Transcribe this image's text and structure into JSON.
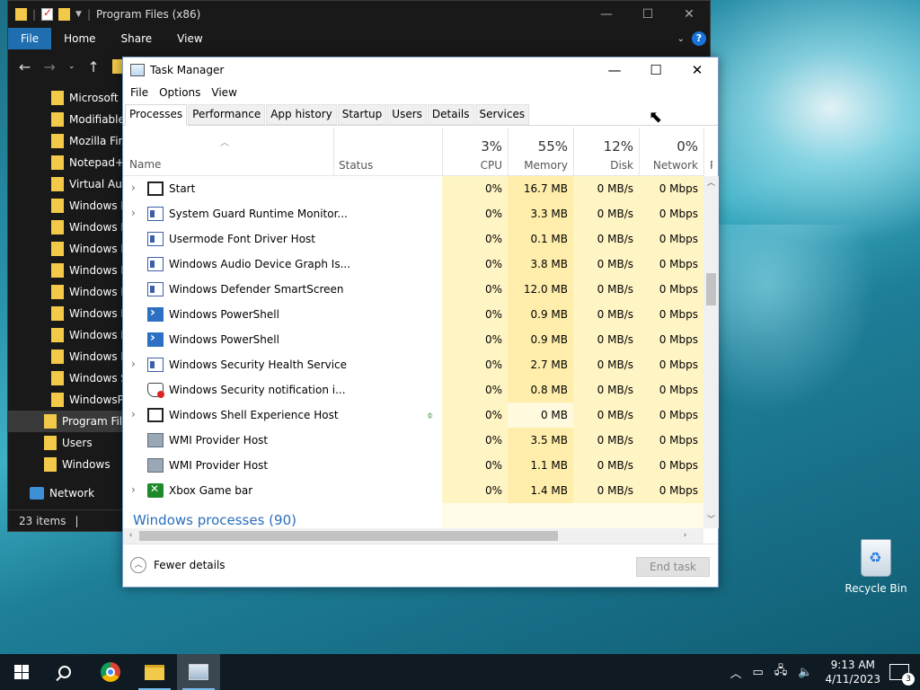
{
  "explorer": {
    "title": "Program Files (x86)",
    "ribbon_tabs": [
      "File",
      "Home",
      "Share",
      "View"
    ],
    "sidebar": [
      {
        "label": "Microsoft S",
        "type": "folder",
        "selected": false
      },
      {
        "label": "Modifiable",
        "type": "folder",
        "selected": false
      },
      {
        "label": "Mozilla Fire",
        "type": "folder",
        "selected": false
      },
      {
        "label": "Notepad++",
        "type": "folder",
        "selected": false
      },
      {
        "label": "Virtual Aud",
        "type": "folder",
        "selected": false
      },
      {
        "label": "Windows D",
        "type": "folder",
        "selected": false
      },
      {
        "label": "Windows D",
        "type": "folder",
        "selected": false
      },
      {
        "label": "Windows M",
        "type": "folder",
        "selected": false
      },
      {
        "label": "Windows M",
        "type": "folder",
        "selected": false
      },
      {
        "label": "Windows M",
        "type": "folder",
        "selected": false
      },
      {
        "label": "Windows N",
        "type": "folder",
        "selected": false
      },
      {
        "label": "Windows P",
        "type": "folder",
        "selected": false
      },
      {
        "label": "Windows P",
        "type": "folder",
        "selected": false
      },
      {
        "label": "Windows S",
        "type": "folder",
        "selected": false
      },
      {
        "label": "WindowsPo",
        "type": "folder",
        "selected": false
      },
      {
        "label": "Program File",
        "type": "folder",
        "selected": true
      },
      {
        "label": "Users",
        "type": "folder",
        "selected": false
      },
      {
        "label": "Windows",
        "type": "folder",
        "selected": false
      },
      {
        "label": "Network",
        "type": "network",
        "selected": false
      }
    ],
    "status": "23 items"
  },
  "taskmgr": {
    "title": "Task Manager",
    "menu": [
      "File",
      "Options",
      "View"
    ],
    "tabs": [
      "Processes",
      "Performance",
      "App history",
      "Startup",
      "Users",
      "Details",
      "Services"
    ],
    "active_tab": "Processes",
    "columns": {
      "name": "Name",
      "status": "Status",
      "cpu": {
        "pct": "3%",
        "label": "CPU"
      },
      "memory": {
        "pct": "55%",
        "label": "Memory"
      },
      "disk": {
        "pct": "12%",
        "label": "Disk"
      },
      "network": {
        "pct": "0%",
        "label": "Network"
      },
      "next": "P"
    },
    "processes": [
      {
        "name": "Start",
        "icon": "start",
        "expand": true,
        "cpu": "0%",
        "mem": "16.7 MB",
        "disk": "0 MB/s",
        "net": "0 Mbps"
      },
      {
        "name": "System Guard Runtime Monitor...",
        "icon": "win",
        "expand": true,
        "cpu": "0%",
        "mem": "3.3 MB",
        "disk": "0 MB/s",
        "net": "0 Mbps"
      },
      {
        "name": "Usermode Font Driver Host",
        "icon": "win",
        "expand": false,
        "cpu": "0%",
        "mem": "0.1 MB",
        "disk": "0 MB/s",
        "net": "0 Mbps"
      },
      {
        "name": "Windows Audio Device Graph Is...",
        "icon": "win",
        "expand": false,
        "cpu": "0%",
        "mem": "3.8 MB",
        "disk": "0 MB/s",
        "net": "0 Mbps"
      },
      {
        "name": "Windows Defender SmartScreen",
        "icon": "win",
        "expand": false,
        "cpu": "0%",
        "mem": "12.0 MB",
        "disk": "0 MB/s",
        "net": "0 Mbps"
      },
      {
        "name": "Windows PowerShell",
        "icon": "ps",
        "expand": false,
        "cpu": "0%",
        "mem": "0.9 MB",
        "disk": "0 MB/s",
        "net": "0 Mbps"
      },
      {
        "name": "Windows PowerShell",
        "icon": "ps",
        "expand": false,
        "cpu": "0%",
        "mem": "0.9 MB",
        "disk": "0 MB/s",
        "net": "0 Mbps"
      },
      {
        "name": "Windows Security Health Service",
        "icon": "win",
        "expand": true,
        "cpu": "0%",
        "mem": "2.7 MB",
        "disk": "0 MB/s",
        "net": "0 Mbps"
      },
      {
        "name": "Windows Security notification i...",
        "icon": "shield",
        "expand": false,
        "cpu": "0%",
        "mem": "0.8 MB",
        "disk": "0 MB/s",
        "net": "0 Mbps"
      },
      {
        "name": "Windows Shell Experience Host",
        "icon": "start",
        "expand": true,
        "leaf": true,
        "cpu": "0%",
        "mem": "0 MB",
        "disk": "0 MB/s",
        "net": "0 Mbps"
      },
      {
        "name": "WMI Provider Host",
        "icon": "wmi",
        "expand": false,
        "cpu": "0%",
        "mem": "3.5 MB",
        "disk": "0 MB/s",
        "net": "0 Mbps"
      },
      {
        "name": "WMI Provider Host",
        "icon": "wmi",
        "expand": false,
        "cpu": "0%",
        "mem": "1.1 MB",
        "disk": "0 MB/s",
        "net": "0 Mbps"
      },
      {
        "name": "Xbox Game bar",
        "icon": "xbox",
        "expand": true,
        "cpu": "0%",
        "mem": "1.4 MB",
        "disk": "0 MB/s",
        "net": "0 Mbps"
      }
    ],
    "group_label": "Windows processes (90)",
    "fewer_details": "Fewer details",
    "end_task": "End task"
  },
  "desktop": {
    "recycle_bin": "Recycle Bin"
  },
  "taskbar": {
    "time": "9:13 AM",
    "date": "4/11/2023",
    "notifications": "3"
  }
}
